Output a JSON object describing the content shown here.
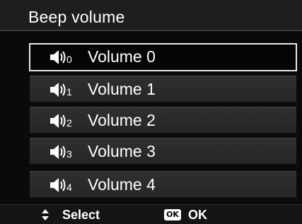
{
  "header": {
    "title": "Beep volume"
  },
  "menu": {
    "items": [
      {
        "label": "Volume 0",
        "level": "0",
        "selected": true
      },
      {
        "label": "Volume 1",
        "level": "1",
        "selected": false
      },
      {
        "label": "Volume 2",
        "level": "2",
        "selected": false
      },
      {
        "label": "Volume 3",
        "level": "3",
        "selected": false
      },
      {
        "label": "Volume 4",
        "level": "4",
        "selected": false
      }
    ],
    "icon": "speaker-icon"
  },
  "footer": {
    "nav_icon": "up-down-arrows-icon",
    "select_label": "Select",
    "ok_badge": "OK",
    "ok_label": "OK"
  },
  "colors": {
    "background": "#0a0a0a",
    "title_bar": "#1e1e1e",
    "item_bg": "#2b2b2b",
    "selected_border": "#e9e9e9",
    "text": "#ffffff"
  }
}
